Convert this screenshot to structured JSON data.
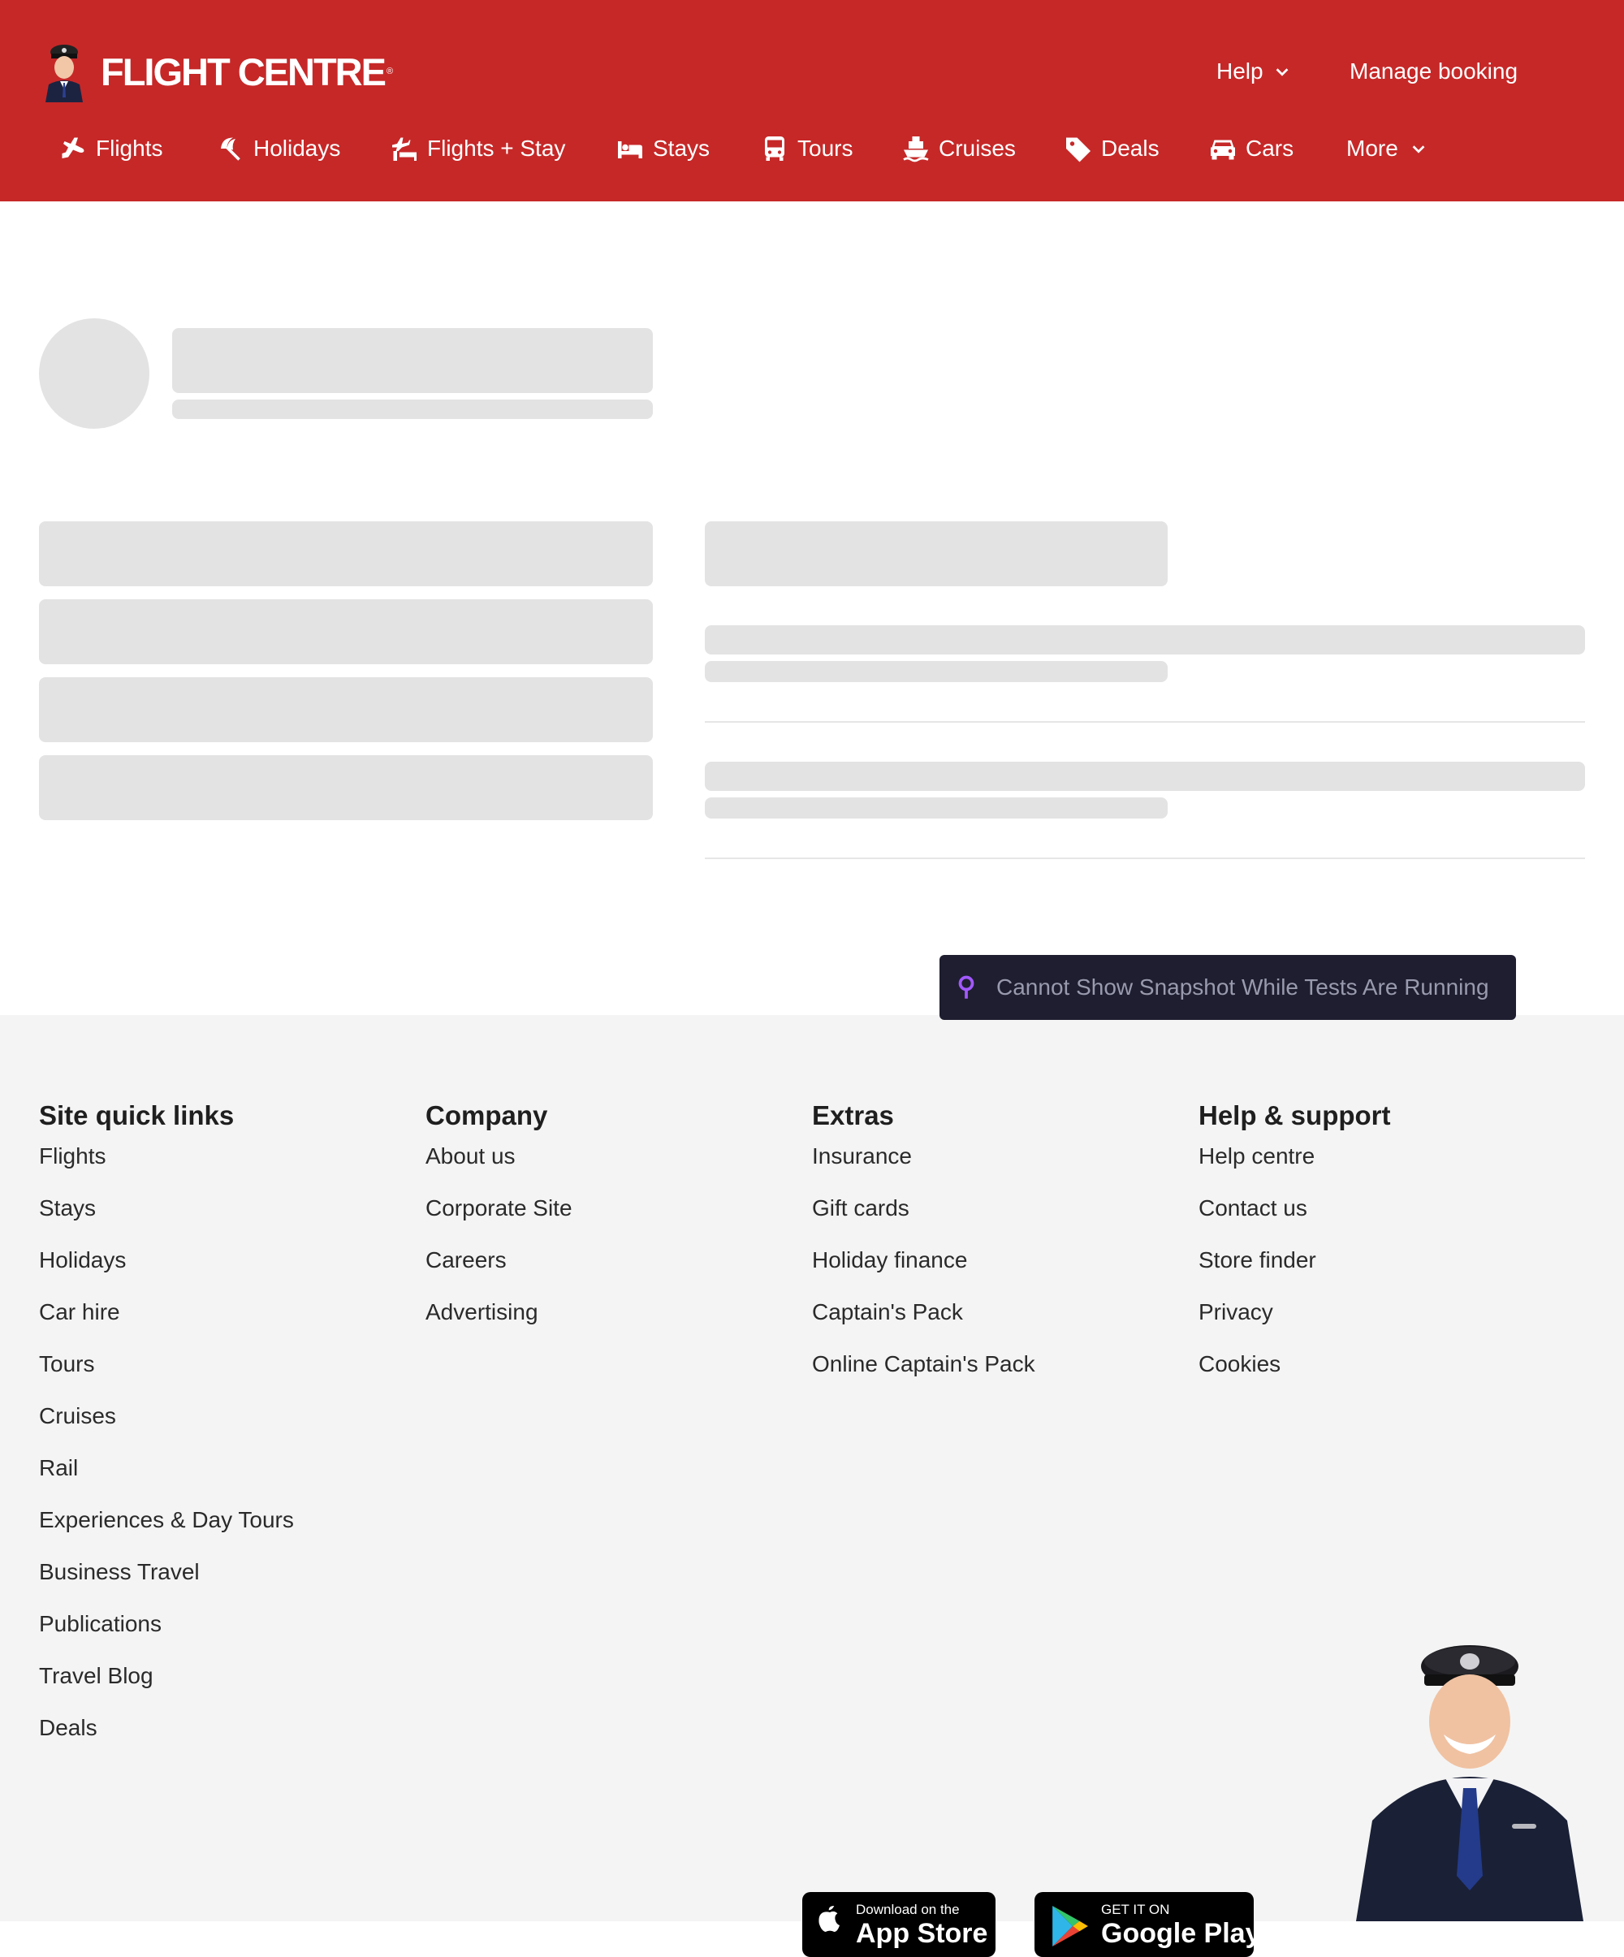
{
  "brand": {
    "name": "FLIGHT CENTRE",
    "reg": "®"
  },
  "header": {
    "help_label": "Help",
    "manage_label": "Manage booking",
    "nav": [
      {
        "label": "Flights",
        "icon": "plane-icon"
      },
      {
        "label": "Holidays",
        "icon": "beach-umbrella-icon"
      },
      {
        "label": "Flights + Stay",
        "icon": "flight-stay-icon"
      },
      {
        "label": "Stays",
        "icon": "bed-icon"
      },
      {
        "label": "Tours",
        "icon": "bus-icon"
      },
      {
        "label": "Cruises",
        "icon": "ship-icon"
      },
      {
        "label": "Deals",
        "icon": "tag-icon"
      },
      {
        "label": "Cars",
        "icon": "car-icon"
      },
      {
        "label": "More",
        "icon": "chevron-down-icon"
      }
    ]
  },
  "colors": {
    "brand_red": "#c62828",
    "skeleton": "#e3e3e3",
    "footer_bg": "#f4f4f4",
    "toast_bg": "#1e1e30",
    "toast_icon": "#a259ff"
  },
  "toast": {
    "text": "Cannot Show Snapshot While Tests Are Running"
  },
  "footer": {
    "columns": [
      {
        "heading": "Site quick links",
        "links": [
          "Flights",
          "Stays",
          "Holidays",
          "Car hire",
          "Tours",
          "Cruises",
          "Rail",
          "Experiences & Day Tours",
          "Business Travel",
          "Publications",
          "Travel Blog",
          "Deals"
        ]
      },
      {
        "heading": "Company",
        "links": [
          "About us",
          "Corporate Site",
          "Careers",
          "Advertising"
        ]
      },
      {
        "heading": "Extras",
        "links": [
          "Insurance",
          "Gift cards",
          "Holiday finance",
          "Captain's Pack",
          "Online Captain's Pack"
        ]
      },
      {
        "heading": "Help & support",
        "links": [
          "Help centre",
          "Contact us",
          "Store finder",
          "Privacy",
          "Cookies"
        ]
      }
    ],
    "app_store": {
      "small": "Download on the",
      "big": "App Store"
    },
    "google_play": {
      "small": "GET IT ON",
      "big": "Google Play"
    }
  }
}
